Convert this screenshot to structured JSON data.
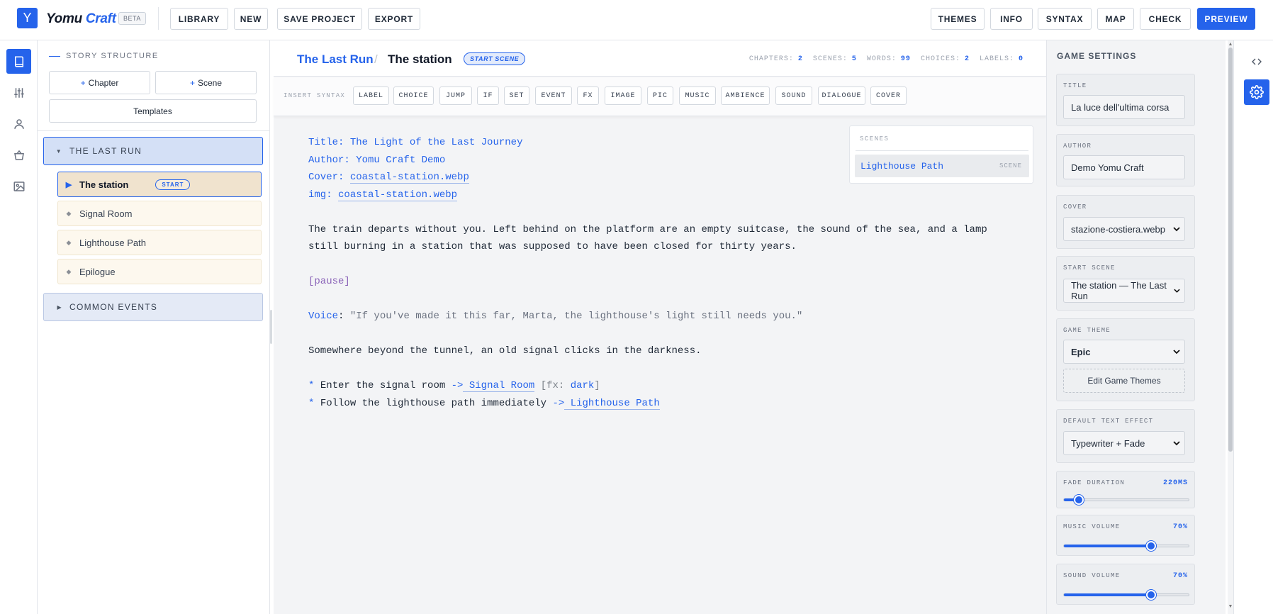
{
  "app": {
    "brand_main": "Yomu",
    "brand_accent": "Craft",
    "beta": "BETA",
    "logo_glyph": "Y"
  },
  "toolbar": {
    "left": [
      "LIBRARY",
      "NEW",
      "SAVE PROJECT",
      "EXPORT"
    ],
    "right": [
      "THEMES",
      "INFO",
      "SYNTAX",
      "MAP",
      "CHECK"
    ],
    "preview": "PREVIEW"
  },
  "rail": {
    "icons": [
      "book-icon",
      "sliders-icon",
      "user-icon",
      "basket-icon",
      "image-icon"
    ]
  },
  "structure": {
    "title": "STORY STRUCTURE",
    "add_chapter": "Chapter",
    "add_scene": "Scene",
    "plus": "+",
    "templates": "Templates",
    "chapter_open": "THE LAST RUN",
    "scenes": [
      "The station",
      "Signal Room",
      "Lighthouse Path",
      "Epilogue"
    ],
    "start_badge": "START",
    "chapter_collapsed": "COMMON EVENTS"
  },
  "editor": {
    "breadcrumb_chapter": "The Last Run",
    "breadcrumb_sep": "/",
    "breadcrumb_scene": "The station",
    "scene_badge": "START SCENE",
    "stats": {
      "chapters_label": "CHAPTERS:",
      "chapters": "2",
      "scenes_label": "SCENES:",
      "scenes": "5",
      "words_label": "WORDS:",
      "words": "99",
      "choices_label": "CHOICES:",
      "choices": "2",
      "labels_label": "LABELS:",
      "labels": "0"
    },
    "syntax_label": "INSERT SYNTAX",
    "syntax_buttons": [
      "LABEL",
      "CHOICE",
      "JUMP",
      "IF",
      "SET",
      "EVENT",
      "FX",
      "IMAGE",
      "PIC",
      "MUSIC",
      "AMBIENCE",
      "SOUND",
      "DIALOGUE",
      "COVER"
    ],
    "code": {
      "title_key": "Title:",
      "title_val": "The Light of the Last Journey",
      "author_key": "Author:",
      "author_val": "Yomu Craft Demo",
      "cover_key": "Cover:",
      "cover_val": "coastal-station.webp",
      "img_key": "img:",
      "img_val": "coastal-station.webp",
      "para1_line1": "The train departs without you. Left behind on the platform are an empty suitcase, the sound of the sea, and a lamp",
      "para1_line2": "still burning in a station that was supposed to have been closed for thirty years.",
      "pause": "[pause]",
      "voice_key": "Voice",
      "voice_colon": ":",
      "voice_text": "\"If you've made it this far, Marta, the lighthouse's light still needs you.\"",
      "para2": "Somewhere beyond the tunnel, an old signal clicks in the darkness.",
      "choice_star": "*",
      "choice1_text": "Enter the signal room",
      "arrow": "->",
      "choice1_target": "Signal Room",
      "choice1_fx_open": "[fx:",
      "choice1_fx_val": "dark",
      "choice1_fx_close": "]",
      "choice2_text": "Follow the lighthouse path immediately",
      "choice2_target": "Lighthouse Path"
    },
    "scenes_popup": {
      "label": "SCENES",
      "item": "Lighthouse Path",
      "type": "SCENE"
    }
  },
  "settings": {
    "title": "GAME SETTINGS",
    "title_label": "TITLE",
    "title_value": "La luce dell'ultima corsa",
    "author_label": "AUTHOR",
    "author_value": "Demo Yomu Craft",
    "cover_label": "COVER",
    "cover_value": "stazione-costiera.webp",
    "start_label": "START SCENE",
    "start_value": "The station — The Last Run",
    "theme_label": "GAME THEME",
    "theme_value": "Epic",
    "edit_themes": "Edit Game Themes",
    "effect_label": "DEFAULT TEXT EFFECT",
    "effect_value": "Typewriter + Fade",
    "fade_label": "FADE DURATION",
    "fade_value": "220MS",
    "fade_fraction": 0.12,
    "music_label": "MUSIC VOLUME",
    "music_value": "70%",
    "music_fraction": 0.7,
    "sound_label": "SOUND VOLUME",
    "sound_value": "70%",
    "sound_fraction": 0.7
  },
  "right_rail": {
    "icons": [
      "code-icon",
      "gear-icon"
    ]
  },
  "colors": {
    "accent": "#2563eb",
    "chapter_bg": "#d4e0f6",
    "scene_bg": "#fdf8ee",
    "active_scene_bg": "#f0e3ce"
  }
}
